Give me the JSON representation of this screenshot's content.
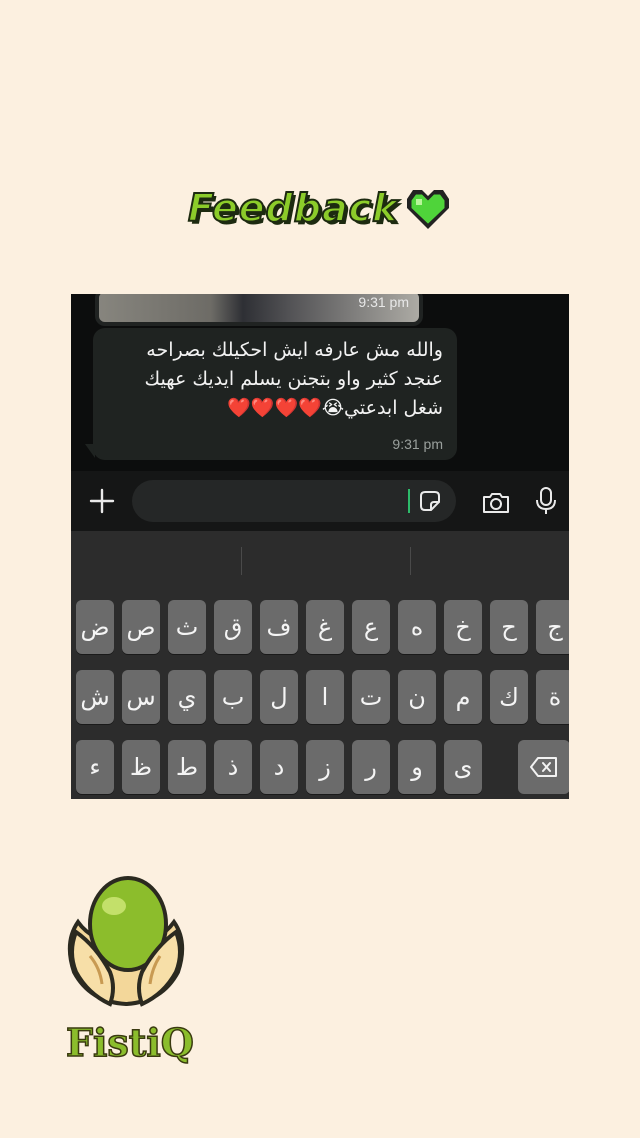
{
  "heading": {
    "text": "Feedback",
    "emoji": "green-heart"
  },
  "chat": {
    "image_message": {
      "time": "9:31 pm"
    },
    "text_message": {
      "lines": [
        "والله مش عارفه ايش احكيلك بصراحه",
        "عنجد كثير واو بتجنن يسلم ايديك عهيك",
        "شغل ابدعتي😭❤️❤️❤️❤️"
      ],
      "time": "9:31 pm"
    }
  },
  "composer": {
    "icons": [
      "plus-icon",
      "sticker-icon",
      "camera-icon",
      "mic-icon"
    ]
  },
  "keyboard": {
    "row1": [
      "ج",
      "ح",
      "خ",
      "ه",
      "ع",
      "غ",
      "ف",
      "ق",
      "ث",
      "ص",
      "ض"
    ],
    "row2": [
      "ة",
      "ك",
      "م",
      "ن",
      "ت",
      "ا",
      "ل",
      "ب",
      "ي",
      "س",
      "ش"
    ],
    "row3": [
      "ى",
      "و",
      "ر",
      "ز",
      "د",
      "ذ",
      "ط",
      "ظ",
      "ء"
    ]
  },
  "brand": {
    "name": "FistiQ"
  },
  "colors": {
    "background": "#fcf0e0",
    "accent_green": "#8ccc2a",
    "caret": "#2dbb6a"
  }
}
